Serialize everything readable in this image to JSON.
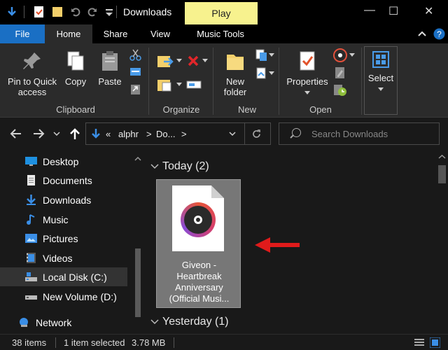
{
  "titlebar": {
    "title": "Downloads",
    "contextual_tab": "Play",
    "min": "—",
    "max": "☐",
    "close": "✕"
  },
  "tabs": {
    "items": [
      "File",
      "Home",
      "Share",
      "View",
      "Music Tools"
    ],
    "expand_icon": "chevron-up-icon",
    "help_icon": "help-icon"
  },
  "ribbon": {
    "clipboard": {
      "pin_label_1": "Pin to Quick",
      "pin_label_2": "access",
      "copy_label": "Copy",
      "paste_label": "Paste",
      "group": "Clipboard"
    },
    "organize": {
      "group": "Organize"
    },
    "new": {
      "folder_label_1": "New",
      "folder_label_2": "folder",
      "group": "New"
    },
    "open": {
      "properties_label": "Properties",
      "group": "Open"
    },
    "select": {
      "label": "Select"
    }
  },
  "address": {
    "prefix": "«",
    "crumb1": "alphr",
    "crumb2": "Do...",
    "sep": ">",
    "search_placeholder": "Search Downloads"
  },
  "sidebar": {
    "items": [
      {
        "label": "Desktop",
        "icon": "desktop-icon"
      },
      {
        "label": "Documents",
        "icon": "documents-icon"
      },
      {
        "label": "Downloads",
        "icon": "downloads-icon"
      },
      {
        "label": "Music",
        "icon": "music-icon"
      },
      {
        "label": "Pictures",
        "icon": "pictures-icon"
      },
      {
        "label": "Videos",
        "icon": "videos-icon"
      },
      {
        "label": "Local Disk (C:)",
        "icon": "drive-icon"
      },
      {
        "label": "New Volume (D:)",
        "icon": "drive-icon"
      },
      {
        "label": "Network",
        "icon": "network-icon"
      }
    ]
  },
  "content": {
    "group_today": "Today (2)",
    "group_yesterday": "Yesterday (1)",
    "file": {
      "line1": "Giveon -",
      "line2": "Heartbreak",
      "line3": "Anniversary",
      "line4": "(Official Musi..."
    }
  },
  "status": {
    "items": "38 items",
    "selected": "1 item selected",
    "size": "3.78 MB"
  },
  "colors": {
    "file_tab": "#1a6fc4",
    "play_tab": "#f7f28e",
    "annotation_arrow": "#e01b1b"
  }
}
